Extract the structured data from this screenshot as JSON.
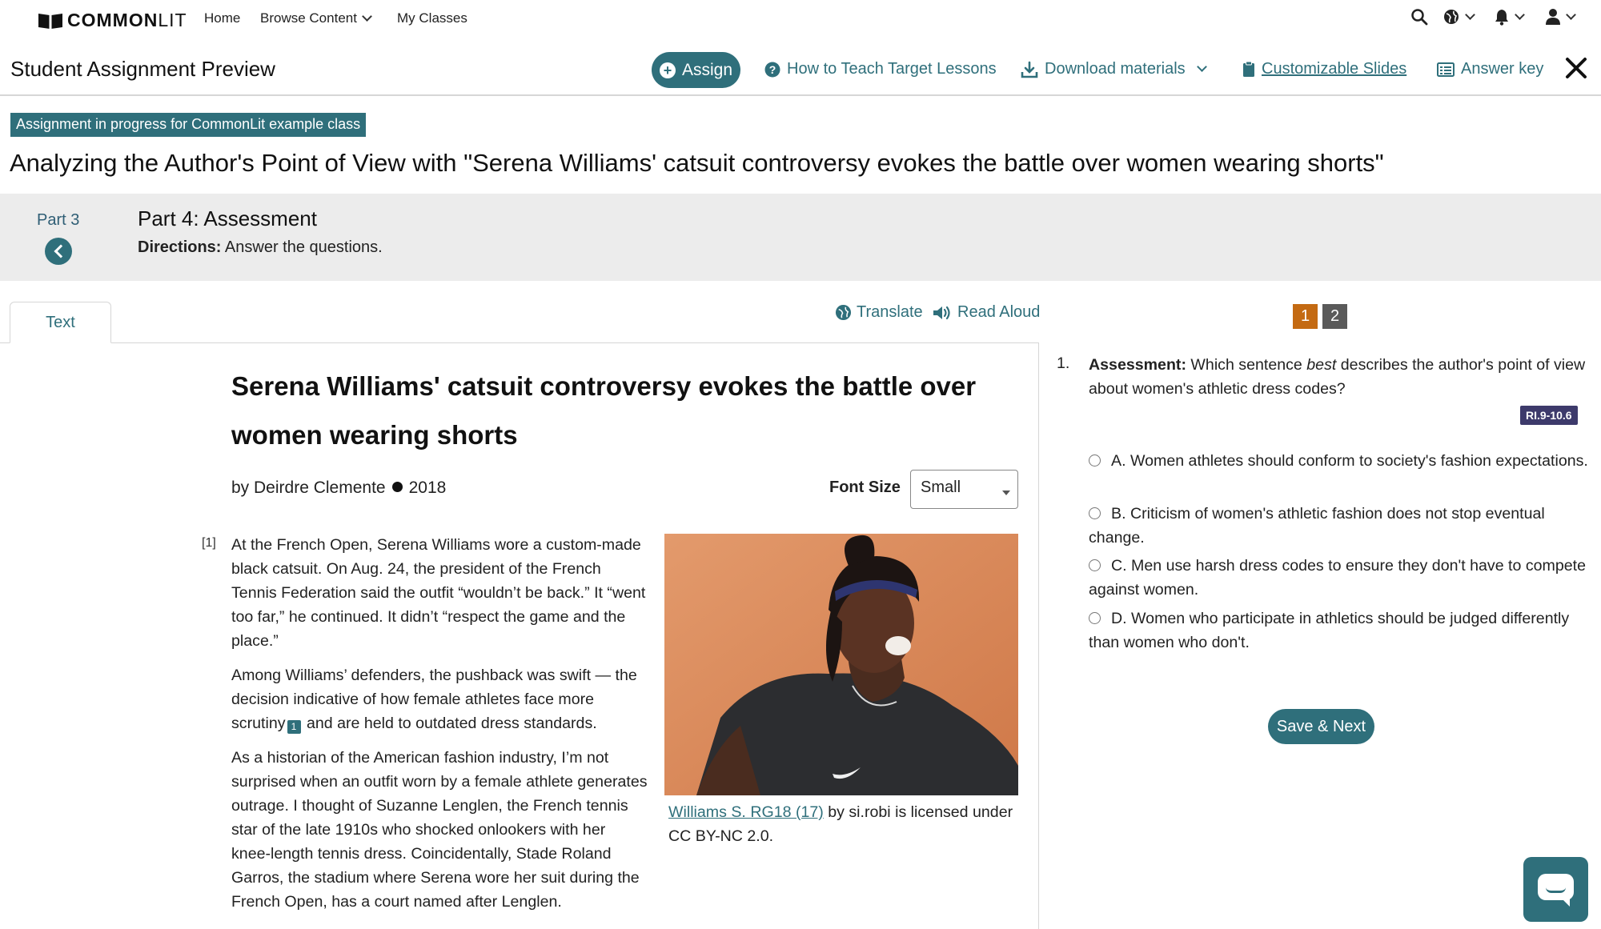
{
  "nav": {
    "logo_bold": "COMMON",
    "logo_light": "LIT",
    "home": "Home",
    "browse": "Browse Content",
    "my_classes": "My Classes",
    "icons": [
      "search-icon",
      "globe-icon",
      "bell-icon",
      "user-icon"
    ]
  },
  "toolbar": {
    "title": "Student Assignment Preview",
    "assign": "Assign",
    "how_to_teach": "How to Teach Target Lessons",
    "download": "Download materials",
    "slides": "Customizable Slides",
    "answer_key": "Answer key",
    "close_icon": "close-icon"
  },
  "assignment": {
    "badge": "Assignment in progress for CommonLit example class",
    "title": "Analyzing the Author's Point of View with \"Serena Williams' catsuit controversy evokes the battle over women wearing shorts\""
  },
  "part": {
    "previous_label": "Part 3",
    "title": "Part 4: Assessment",
    "directions_label": "Directions:",
    "directions_text": " Answer the questions."
  },
  "reader": {
    "tab": "Text",
    "translate": "Translate",
    "read_aloud": "Read Aloud",
    "article_title": "Serena Williams' catsuit controversy evokes the battle over women wearing shorts",
    "author": "by Deirdre Clemente",
    "year": "2018",
    "font_size_label": "Font Size",
    "font_size_value": "Small",
    "para_number": "[1]",
    "para1": "At the French Open, Serena Williams wore a custom-made black catsuit. On Aug. 24, the president of the French Tennis Federation said the outfit “wouldn’t be back.” It “went too far,” he continued. It didn’t “respect the game and the place.”",
    "para2_a": "Among Williams’ defenders, the pushback was swift — the decision indicative of how female athletes face more scrutiny",
    "para2_footnote": "1",
    "para2_b": " and are held to outdated dress standards.",
    "para3": "As a historian of the American fashion industry, I’m not surprised when an outfit worn by a female athlete generates outrage. I thought of Suzanne Lenglen, the French tennis star of the late 1910s who shocked onlookers with her knee-length tennis dress. Coincidentally, Stade Roland Garros, the stadium where Serena wore her suit during the French Open, has a court named after Lenglen.",
    "caption_link": "Williams S. RG18 (17)",
    "caption_text": " by si.robi is licensed under CC BY-NC 2.0."
  },
  "questions": {
    "pages": [
      "1",
      "2"
    ],
    "active_color": "#c46a12",
    "inactive_color": "#5a5a5a",
    "number": "1.",
    "label": "Assessment:",
    "text_before": " Which sentence ",
    "text_em": "best",
    "text_after": " describes the author's point of view about women's athletic dress codes?",
    "standard": "RI.9-10.6",
    "options": [
      "A. Women athletes should conform to society's fashion expectations.",
      "B. Criticism of women's athletic fashion does not stop eventual change.",
      "C. Men use harsh dress codes to ensure they don't have to compete against women.",
      "D. Women who participate in athletics should be judged differently than women who don't."
    ],
    "save_next": "Save & Next"
  },
  "colors": {
    "brand": "#2f6f7b",
    "part_bar": "#ececec"
  }
}
